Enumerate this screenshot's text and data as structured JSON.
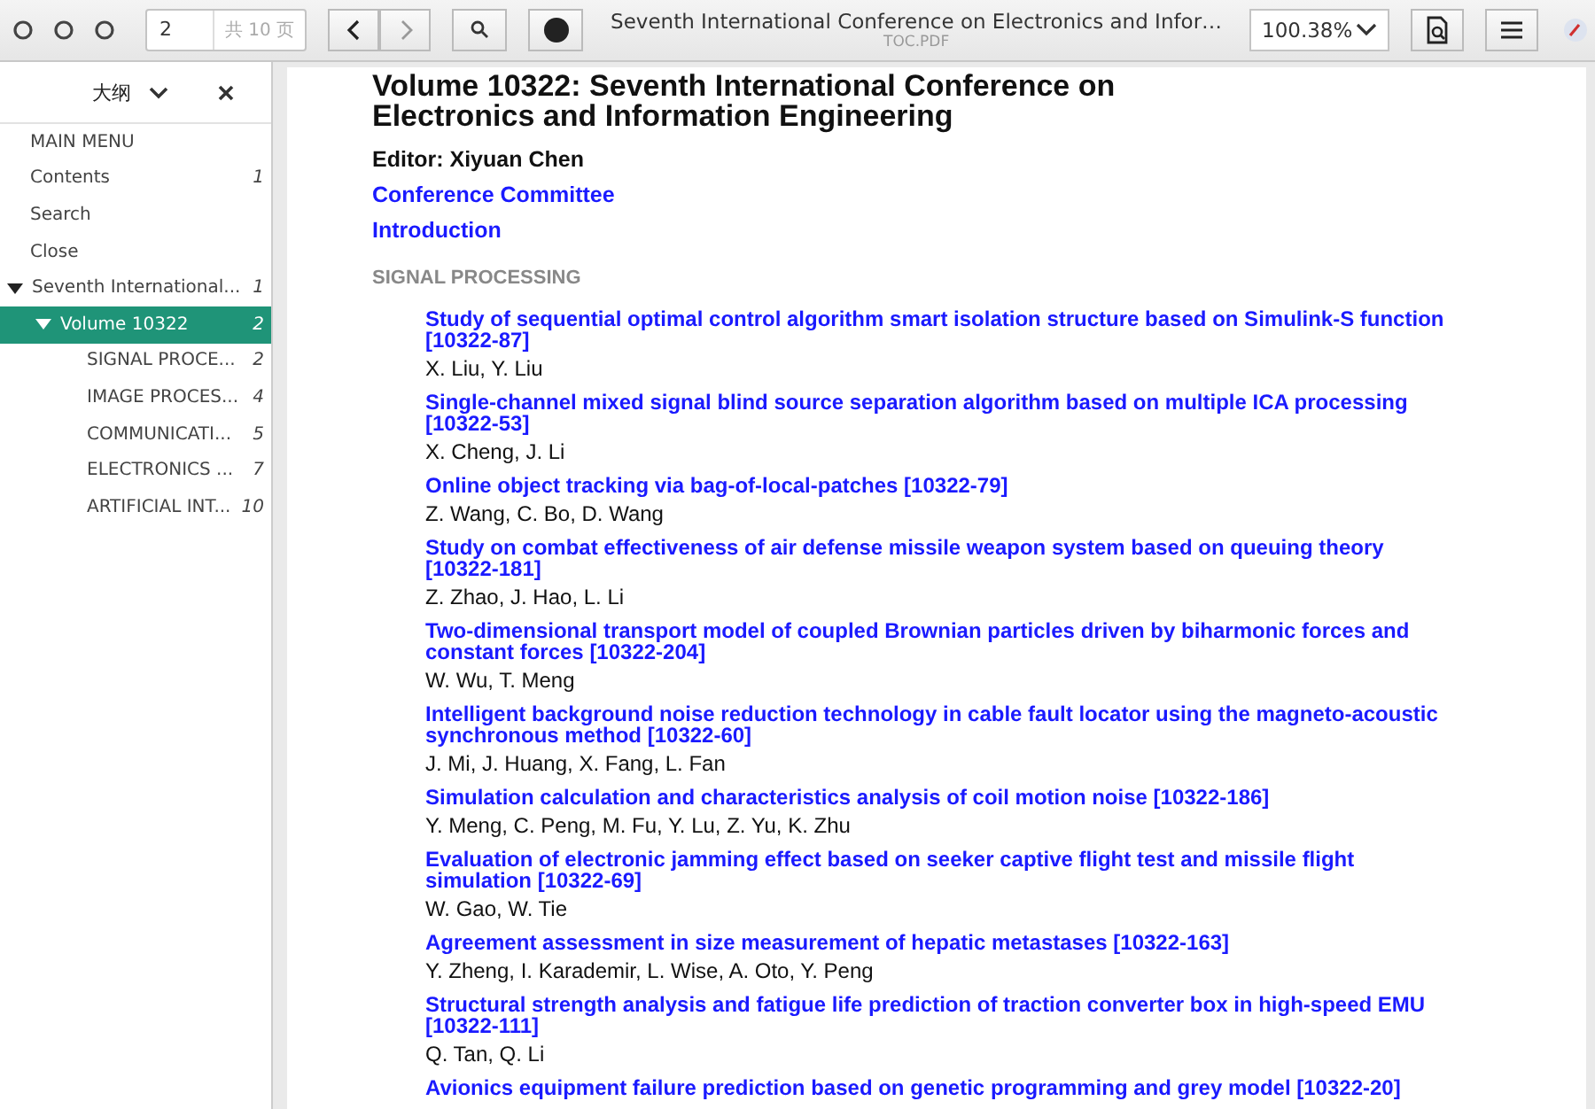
{
  "toolbar": {
    "page_value": "2",
    "page_total": "共 10 页",
    "title": "Seventh International Conference on Electronics and Infor…",
    "filename": "TOC.PDF",
    "zoom": "100.38%"
  },
  "sidebar": {
    "title": "大纲",
    "items": [
      {
        "label": "MAIN MENU",
        "selected": false
      },
      {
        "label": "Contents",
        "page": "1",
        "selected": false
      },
      {
        "label": "Search",
        "selected": false
      },
      {
        "label": "Close",
        "selected": false
      },
      {
        "label": "Seventh International...",
        "page": "1",
        "selected": false,
        "expanded": true,
        "children": [
          {
            "label": "Volume 10322",
            "page": "2",
            "selected": true,
            "expanded": true,
            "children": [
              {
                "label": "SIGNAL PROCE...",
                "page": "2",
                "selected": false
              },
              {
                "label": "IMAGE PROCES...",
                "page": "4",
                "selected": false
              },
              {
                "label": "COMMUNICATI...",
                "page": "5",
                "selected": false
              },
              {
                "label": "ELECTRONICS ...",
                "page": "7",
                "selected": false
              },
              {
                "label": "ARTIFICIAL INT...",
                "page": "10",
                "selected": false
              }
            ]
          }
        ]
      }
    ]
  },
  "document": {
    "title": "Volume 10322: Seventh International Conference on Electronics and Information Engineering",
    "editor": "Editor: Xiyuan Chen",
    "links": [
      "Conference Committee",
      "Introduction"
    ],
    "section": "SIGNAL PROCESSING",
    "papers": [
      {
        "title": "Study of sequential optimal control algorithm smart isolation structure based on Simulink-S function [10322-87]",
        "authors": "X. Liu, Y. Liu"
      },
      {
        "title": "Single-channel mixed signal blind source separation algorithm based on multiple ICA processing [10322-53]",
        "authors": "X. Cheng, J. Li"
      },
      {
        "title": "Online object tracking via bag-of-local-patches [10322-79]",
        "authors": "Z. Wang, C. Bo, D. Wang"
      },
      {
        "title": "Study on combat effectiveness of air defense missile weapon system based on queuing theory [10322-181]",
        "authors": "Z. Zhao, J. Hao, L. Li"
      },
      {
        "title": "Two-dimensional transport model of coupled Brownian particles driven by biharmonic forces and constant forces [10322-204]",
        "authors": "W. Wu, T. Meng"
      },
      {
        "title": "Intelligent background noise reduction technology in cable fault locator using the magneto-acoustic synchronous method [10322-60]",
        "authors": "J. Mi, J. Huang, X. Fang, L. Fan"
      },
      {
        "title": "Simulation calculation and characteristics analysis of coil motion noise [10322-186]",
        "authors": "Y. Meng, C. Peng, M. Fu, Y. Lu, Z. Yu, K. Zhu"
      },
      {
        "title": "Evaluation of electronic jamming effect based on seeker captive flight test and missile flight simulation [10322-69]",
        "authors": "W. Gao, W. Tie"
      },
      {
        "title": "Agreement assessment in size measurement of hepatic metastases [10322-163]",
        "authors": "Y. Zheng, I. Karademir, L. Wise, A. Oto, Y. Peng"
      },
      {
        "title": "Structural strength analysis and fatigue life prediction of traction converter box in high-speed EMU [10322-111]",
        "authors": "Q. Tan, Q. Li"
      },
      {
        "title": "Avionics equipment failure prediction based on genetic programming and grey model [10322-20]"
      }
    ]
  }
}
